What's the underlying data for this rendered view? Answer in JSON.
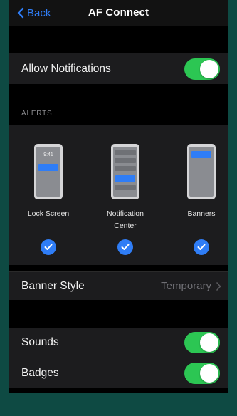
{
  "nav": {
    "back_label": "Back",
    "title": "AF Connect"
  },
  "allow_notifications": {
    "label": "Allow Notifications",
    "on": true
  },
  "alerts": {
    "header": "ALERTS",
    "options": [
      {
        "label": "Lock Screen",
        "checked": true,
        "preview_time": "9:41"
      },
      {
        "label": "Notification Center",
        "checked": true
      },
      {
        "label": "Banners",
        "checked": true
      }
    ]
  },
  "banner_style": {
    "label": "Banner Style",
    "value": "Temporary"
  },
  "sounds": {
    "label": "Sounds",
    "on": true
  },
  "badges": {
    "label": "Badges",
    "on": true
  },
  "colors": {
    "accent": "#2f7df6",
    "toggle_on": "#2cc653",
    "background": "#0e4a43"
  }
}
